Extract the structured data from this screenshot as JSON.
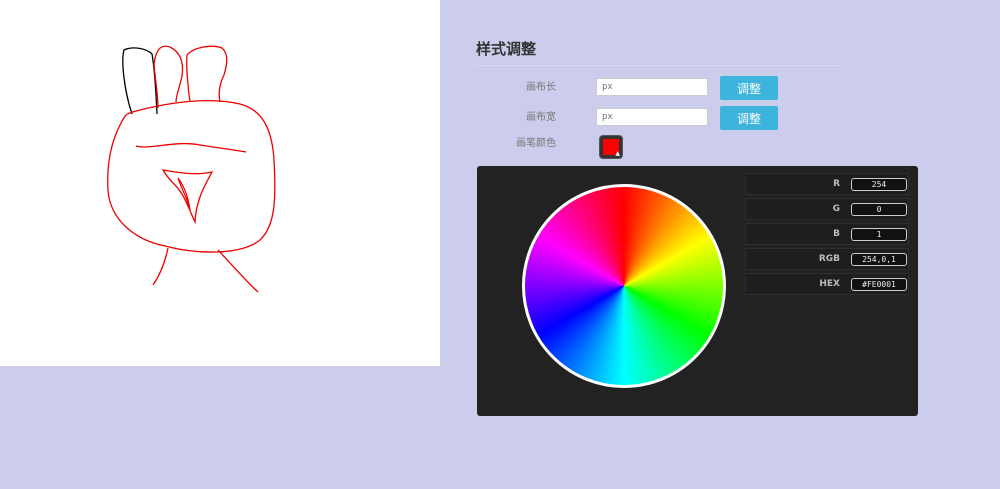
{
  "settings": {
    "title": "样式调整",
    "width_label": "画布长",
    "width_placeholder": "px",
    "height_label": "画布宽",
    "height_placeholder": "px",
    "adjust_label": "调整",
    "pen_color_label": "画笔颜色",
    "pen_color": "#FE0001"
  },
  "picker": {
    "fields": [
      {
        "label": "R",
        "value": "254"
      },
      {
        "label": "G",
        "value": "0"
      },
      {
        "label": "B",
        "value": "1"
      },
      {
        "label": "RGB",
        "value": "254,0,1"
      },
      {
        "label": "HEX",
        "value": "#FE0001"
      }
    ]
  },
  "colors": {
    "background": "#CCCDEC",
    "canvas": "#FFFFFF",
    "button": "#3CB4DC",
    "picker_bg": "#222222",
    "stroke_black": "#000000",
    "stroke_red": "#FF0000"
  }
}
